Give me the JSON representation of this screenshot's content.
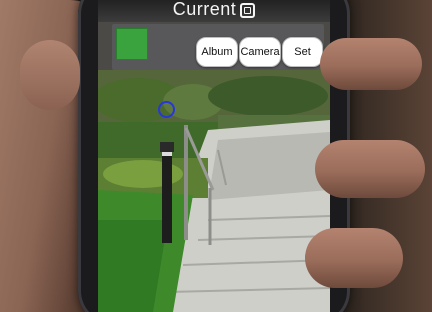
{
  "app": {
    "title": "Current",
    "selected_color": "#3aa33e"
  },
  "toolbar": {
    "album_label": "Album",
    "camera_label": "Camera",
    "set_label": "Set"
  },
  "icons": {
    "title_logo": "app-logo-icon",
    "crosshair": "color-picker-crosshair-icon"
  }
}
